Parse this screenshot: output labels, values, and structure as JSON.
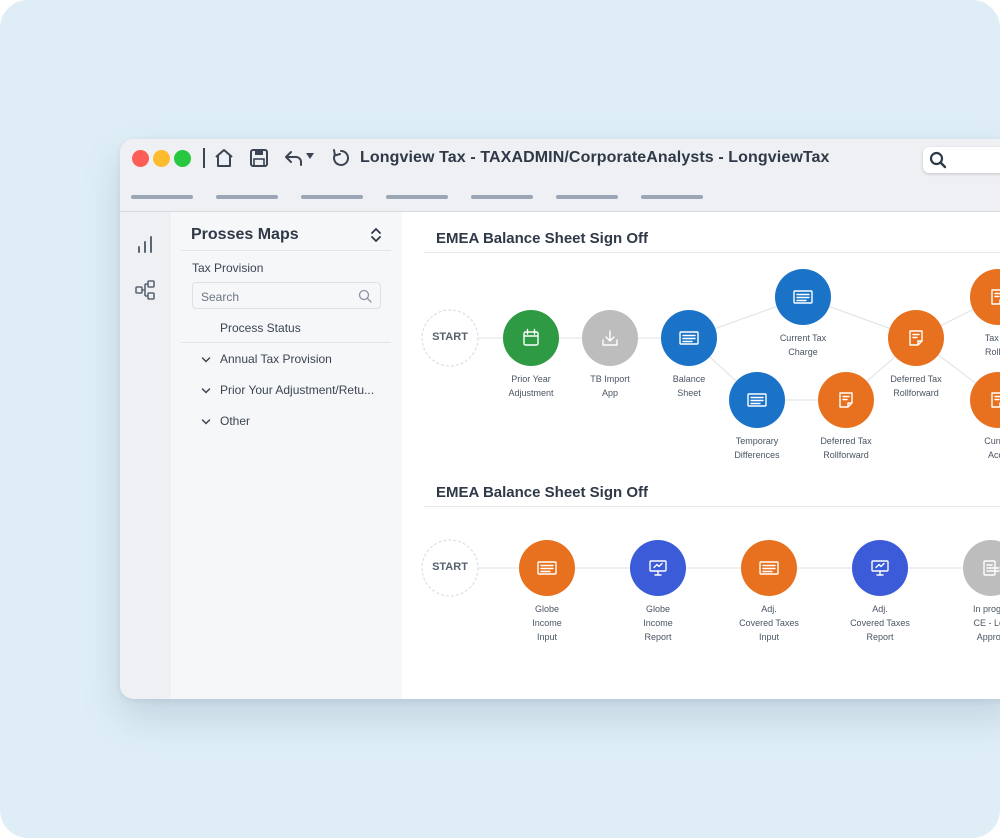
{
  "window": {
    "title": "Longview Tax - TAXADMIN/CorporateAnalysts - LongviewTax",
    "icons": [
      "home-icon",
      "save-icon",
      "undo-icon",
      "dropdown-caret-icon",
      "refresh-icon",
      "search-icon"
    ]
  },
  "sidebar": {
    "title": "Prosses Maps",
    "section": "Tax Provision",
    "search_placeholder": "Search",
    "items": [
      {
        "label": "Process Status"
      },
      {
        "label": "Annual Tax Provision"
      },
      {
        "label": "Prior Your Adjustment/Retu..."
      },
      {
        "label": "Other"
      }
    ]
  },
  "maps": [
    {
      "title": "EMEA Balance Sheet Sign Off",
      "start": "START",
      "nodes": [
        {
          "label1": "Prior Year",
          "label2": "Adjustment",
          "color": "#2e9a43",
          "icon": "calendar-icon"
        },
        {
          "label1": "TB Import",
          "label2": "App",
          "color": "#bdbdbd",
          "icon": "download-icon"
        },
        {
          "label1": "Balance",
          "label2": "Sheet",
          "color": "#1b73c8",
          "icon": "document-icon"
        },
        {
          "label1": "Current Tax",
          "label2": "Charge",
          "color": "#1b73c8",
          "icon": "document-icon"
        },
        {
          "label1": "Temporary",
          "label2": "Differences",
          "color": "#1b73c8",
          "icon": "document-icon"
        },
        {
          "label1": "Deferred Tax",
          "label2": "Rollforward",
          "color": "#e8711f",
          "icon": "notes-icon"
        },
        {
          "label1": "Deferred Tax",
          "label2": "Rollforward",
          "color": "#e8711f",
          "icon": "notes-icon"
        },
        {
          "label1": "Tax Ac",
          "label2": "Rollfor",
          "color": "#e8711f",
          "icon": "notes-icon"
        },
        {
          "label1": "Curren",
          "label2": "Acco",
          "color": "#e8711f",
          "icon": "notes-icon"
        }
      ]
    },
    {
      "title": "EMEA Balance Sheet Sign Off",
      "start": "START",
      "nodes": [
        {
          "label1": "Globe",
          "label2": "Income",
          "label3": "Input",
          "color": "#e8711f",
          "icon": "document-icon"
        },
        {
          "label1": "Globe",
          "label2": "Income",
          "label3": "Report",
          "color": "#3b5bd9",
          "icon": "presentation-icon"
        },
        {
          "label1": "Adj.",
          "label2": "Covered Taxes",
          "label3": "Input",
          "color": "#e8711f",
          "icon": "document-icon"
        },
        {
          "label1": "Adj.",
          "label2": "Covered Taxes",
          "label3": "Report",
          "color": "#3b5bd9",
          "icon": "presentation-icon"
        },
        {
          "label1": "In progre",
          "label2": "CE - Lev",
          "label3": "Approv",
          "color": "#bdbdbd",
          "icon": "form-icon"
        }
      ]
    }
  ]
}
